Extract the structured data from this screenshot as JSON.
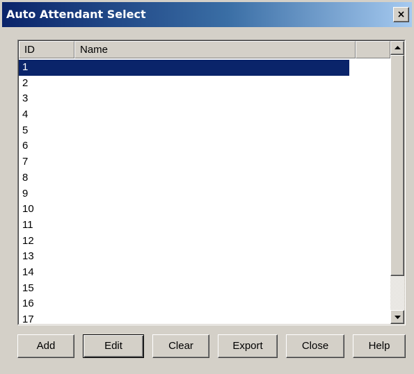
{
  "window": {
    "title": "Auto Attendant Select",
    "close_glyph": "×"
  },
  "list": {
    "columns": [
      "ID",
      "Name",
      ""
    ],
    "rows": [
      {
        "id": "1",
        "name": ""
      },
      {
        "id": "2",
        "name": ""
      },
      {
        "id": "3",
        "name": ""
      },
      {
        "id": "4",
        "name": ""
      },
      {
        "id": "5",
        "name": ""
      },
      {
        "id": "6",
        "name": ""
      },
      {
        "id": "7",
        "name": ""
      },
      {
        "id": "8",
        "name": ""
      },
      {
        "id": "9",
        "name": ""
      },
      {
        "id": "10",
        "name": ""
      },
      {
        "id": "11",
        "name": ""
      },
      {
        "id": "12",
        "name": ""
      },
      {
        "id": "13",
        "name": ""
      },
      {
        "id": "14",
        "name": ""
      },
      {
        "id": "15",
        "name": ""
      },
      {
        "id": "16",
        "name": ""
      },
      {
        "id": "17",
        "name": ""
      }
    ],
    "selected_index": 0
  },
  "buttons": {
    "add": "Add",
    "edit": "Edit",
    "clear": "Clear",
    "export": "Export",
    "close": "Close",
    "help": "Help"
  },
  "colors": {
    "selection": "#0a246a",
    "face": "#d4d0c8"
  },
  "icons": {
    "scroll_up": "scroll-up-arrow-icon",
    "scroll_down": "scroll-down-arrow-icon",
    "close": "close-x-icon"
  }
}
